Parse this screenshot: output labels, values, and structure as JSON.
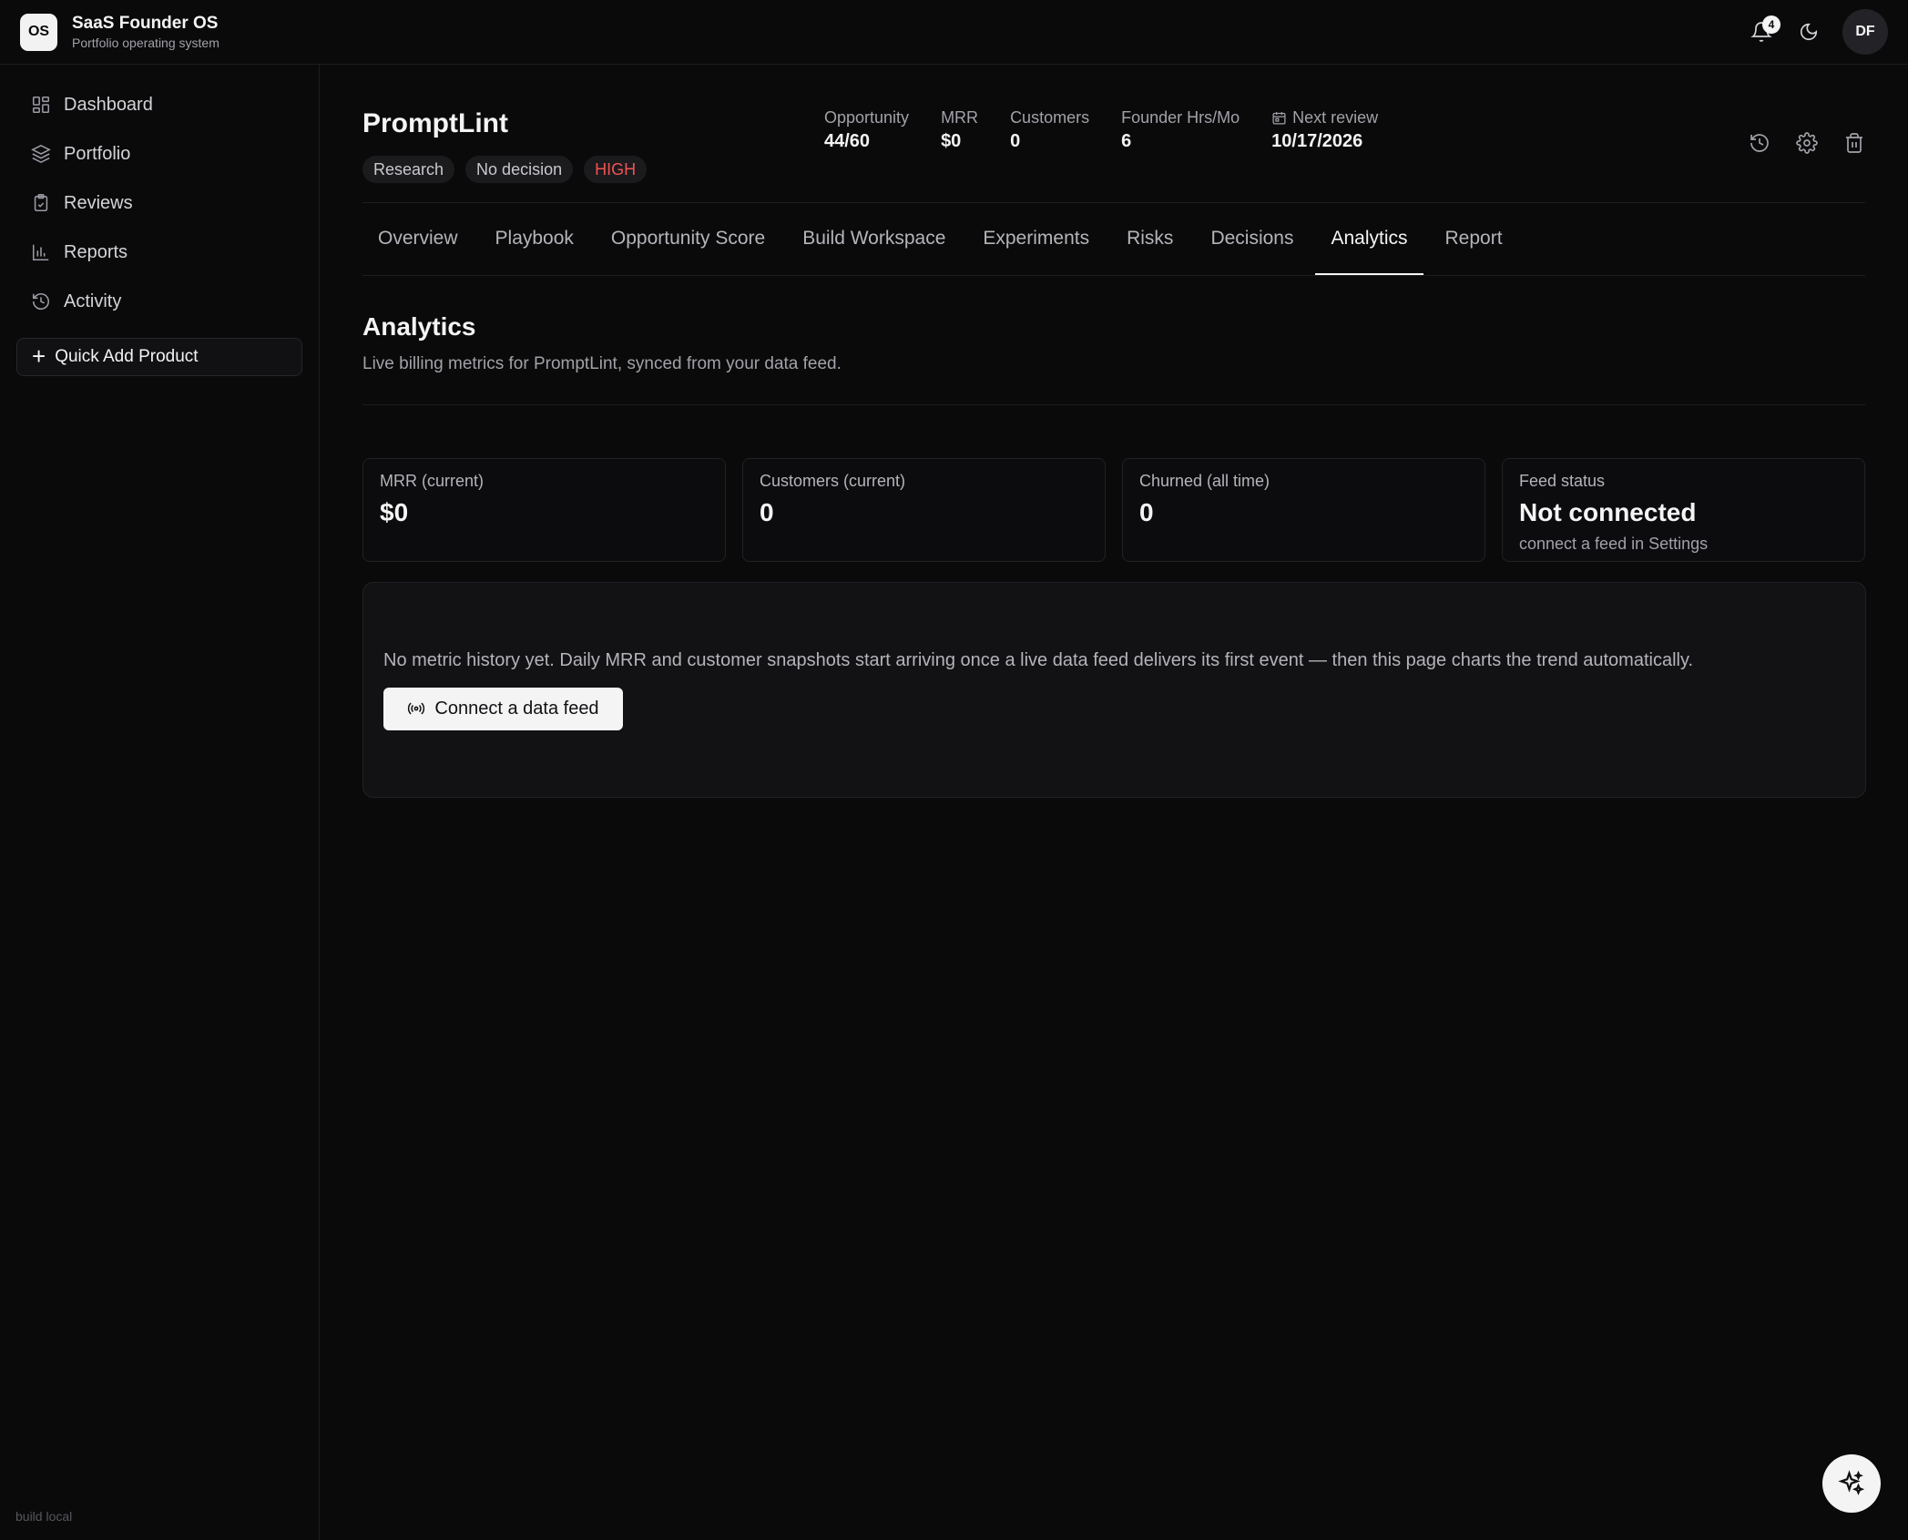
{
  "app": {
    "logo_text": "OS",
    "title": "SaaS Founder OS",
    "subtitle": "Portfolio operating system",
    "notification_count": "4",
    "avatar_initials": "DF",
    "build_label": "build local"
  },
  "sidebar": {
    "items": [
      {
        "label": "Dashboard",
        "icon": "dashboard-icon"
      },
      {
        "label": "Portfolio",
        "icon": "layers-icon"
      },
      {
        "label": "Reviews",
        "icon": "clipboard-icon"
      },
      {
        "label": "Reports",
        "icon": "bar-chart-icon"
      },
      {
        "label": "Activity",
        "icon": "history-icon"
      }
    ],
    "quick_add_label": "Quick Add Product"
  },
  "product": {
    "name": "PromptLint",
    "tags": [
      "Research",
      "No decision",
      "HIGH"
    ],
    "stats": [
      {
        "label": "Opportunity",
        "value": "44/60"
      },
      {
        "label": "MRR",
        "value": "$0"
      },
      {
        "label": "Customers",
        "value": "0"
      },
      {
        "label": "Founder Hrs/Mo",
        "value": "6"
      },
      {
        "label": "Next review",
        "value": "10/17/2026"
      }
    ]
  },
  "tabs": [
    "Overview",
    "Playbook",
    "Opportunity Score",
    "Build Workspace",
    "Experiments",
    "Risks",
    "Decisions",
    "Analytics",
    "Report"
  ],
  "active_tab": "Analytics",
  "analytics": {
    "title": "Analytics",
    "subtitle": "Live billing metrics for PromptLint, synced from your data feed.",
    "cards": [
      {
        "label": "MRR (current)",
        "value": "$0"
      },
      {
        "label": "Customers (current)",
        "value": "0"
      },
      {
        "label": "Churned (all time)",
        "value": "0"
      },
      {
        "label": "Feed status",
        "value": "Not connected",
        "note": "connect a feed in Settings"
      }
    ],
    "empty_text": "No metric history yet. Daily MRR and customer snapshots start arriving once a live data feed delivers its first event — then this page charts the trend automatically.",
    "connect_button": "Connect a data feed"
  },
  "colors": {
    "background": "#0a0a0b",
    "accent": "#f4f4f5",
    "high_tag": "#f05252"
  }
}
